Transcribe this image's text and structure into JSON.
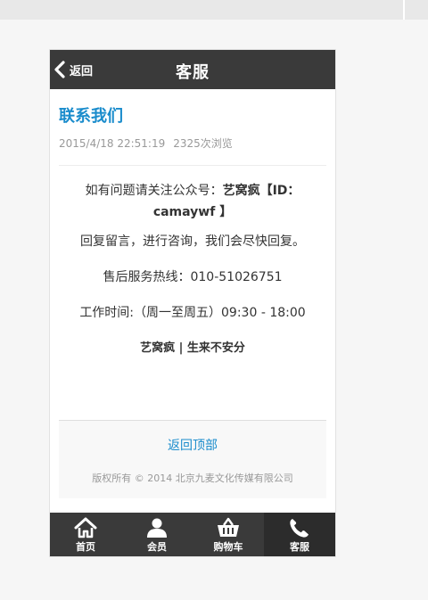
{
  "header": {
    "back_label": "返回",
    "title": "客服"
  },
  "article": {
    "title": "联系我们",
    "date": "2015/4/18 22:51:19",
    "views": "2325次浏览",
    "para1_prefix": "如有问题请关注公众号：",
    "para1_bold": "艺窝疯【ID：camaywf 】",
    "para2": "回复留言，进行咨询，我们会尽快回复。",
    "para3": "售后服务热线：010-51026751",
    "para4": "工作时间:（周一至周五）09:30 - 18:00",
    "para5": "艺窝疯 | 生来不安分"
  },
  "footer": {
    "back_to_top": "返回顶部",
    "copyright": "版权所有 © 2014 北京九麦文化传媒有限公司"
  },
  "tabbar": {
    "items": [
      {
        "label": "首页",
        "icon": "home-icon"
      },
      {
        "label": "会员",
        "icon": "user-icon"
      },
      {
        "label": "购物车",
        "icon": "cart-icon"
      },
      {
        "label": "客服",
        "icon": "phone-icon",
        "active": true
      }
    ]
  },
  "colors": {
    "header_bg": "#3a3a3a",
    "accent": "#1a8ccc"
  }
}
